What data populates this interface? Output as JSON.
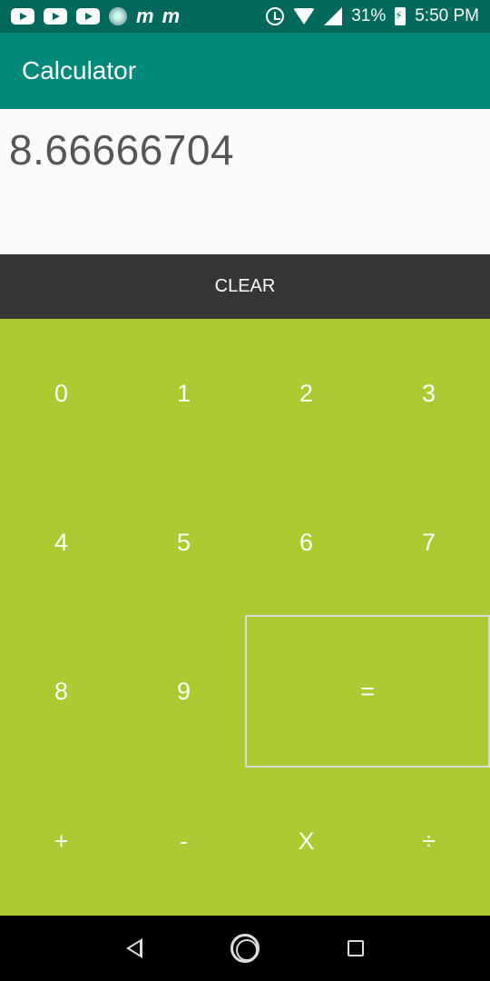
{
  "status_bar": {
    "battery_text": "31%",
    "time": "5:50 PM",
    "notification_icons": [
      "youtube-icon",
      "youtube-icon",
      "youtube-icon",
      "app-circle-icon",
      "m-app-icon",
      "m-app-icon"
    ],
    "system_icons": [
      "alarm-icon",
      "wifi-icon",
      "signal-icon",
      "battery-charging-icon"
    ],
    "m_glyph": "m"
  },
  "app_bar": {
    "title": "Calculator"
  },
  "display": {
    "value": "8.66666704"
  },
  "clear_button": {
    "label": "CLEAR"
  },
  "keypad": {
    "keys": [
      "0",
      "1",
      "2",
      "3",
      "4",
      "5",
      "6",
      "7",
      "8",
      "9",
      "=",
      "+",
      "-",
      "X",
      "÷"
    ]
  },
  "nav_bar": {
    "icons": [
      "back-icon",
      "home-icon",
      "recents-icon"
    ]
  },
  "colors": {
    "status_bar": "#00695c",
    "app_bar": "#00897b",
    "display_bg": "#fafafa",
    "clear_bg": "#363636",
    "keypad_bg": "#acca31",
    "nav_bar": "#000000"
  }
}
